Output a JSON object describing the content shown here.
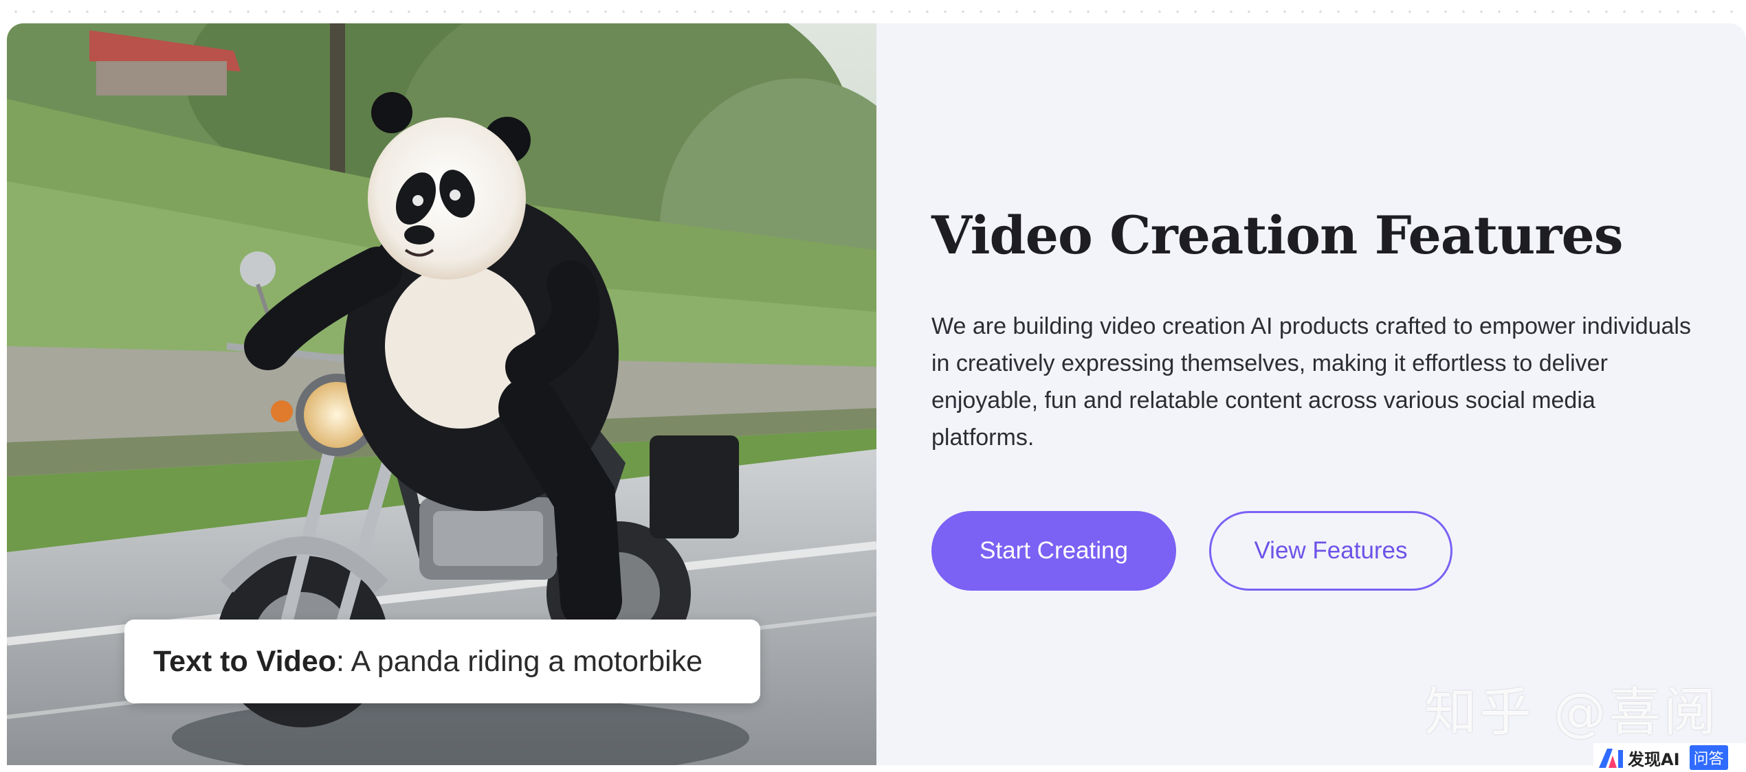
{
  "hero": {
    "caption": {
      "mode_label": "Text to Video",
      "separator": ":",
      "prompt": " A panda riding a motorbike"
    },
    "title": "Video Creation Features",
    "description": "We are building video creation AI products crafted to empower individuals in creatively expressing themselves, making it effortless to deliver enjoyable, fun and relatable content across various social media platforms.",
    "buttons": {
      "primary_label": "Start Creating",
      "secondary_label": "View Features"
    }
  },
  "overlay": {
    "watermark": "知乎 @喜阅",
    "badge_text": "发现AI",
    "badge_tag": "问答"
  },
  "colors": {
    "accent": "#7b61f4",
    "panel_bg": "#f3f4f9",
    "heading": "#1d1d22"
  }
}
